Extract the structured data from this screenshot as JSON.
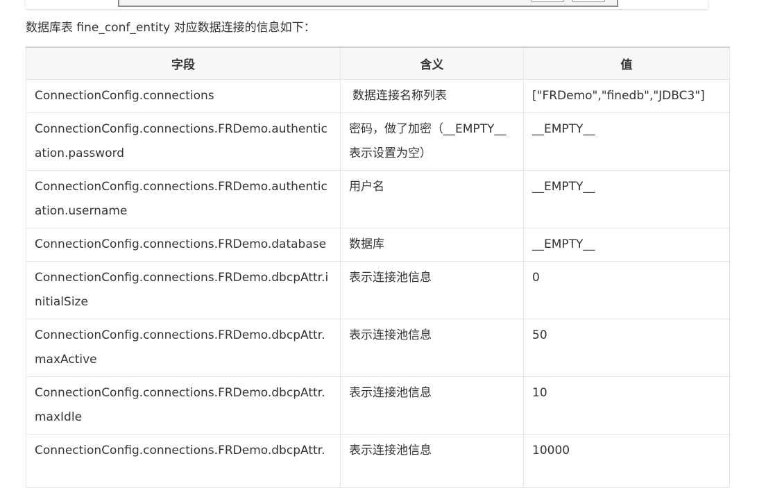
{
  "intro_text": "数据库表 fine_conf_entity 对应数据连接的信息如下：",
  "table": {
    "headers": [
      "字段",
      "含义",
      "值"
    ],
    "rows": [
      {
        "field": "ConnectionConfig.connections",
        "meaning": "数据连接名称列表",
        "value": "[\"FRDemo\",\"finedb\",\"JDBC3\"]"
      },
      {
        "field": "ConnectionConfig.connections.FRDemo.authentication.password",
        "meaning": "密码，做了加密（__EMPTY__表示设置为空）",
        "value": "__EMPTY__"
      },
      {
        "field": "ConnectionConfig.connections.FRDemo.authentication.username",
        "meaning": "用户名",
        "value": "__EMPTY__"
      },
      {
        "field": "ConnectionConfig.connections.FRDemo.database",
        "meaning": "数据库",
        "value": "__EMPTY__"
      },
      {
        "field": "ConnectionConfig.connections.FRDemo.dbcpAttr.initialSize",
        "meaning": "表示连接池信息",
        "value": "0"
      },
      {
        "field": "ConnectionConfig.connections.FRDemo.dbcpAttr.maxActive",
        "meaning": "表示连接池信息",
        "value": "50"
      },
      {
        "field": "ConnectionConfig.connections.FRDemo.dbcpAttr.maxIdle",
        "meaning": "表示连接池信息",
        "value": "10"
      },
      {
        "field": "ConnectionConfig.connections.FRDemo.dbcpAttr.",
        "meaning": "表示连接池信息",
        "value": "10000"
      }
    ]
  }
}
